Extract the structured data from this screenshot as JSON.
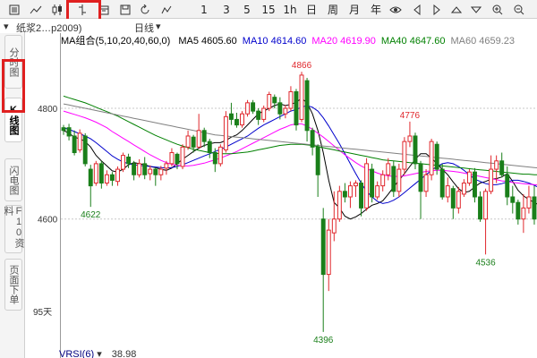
{
  "toolbar": {
    "items": [
      {
        "name": "list-icon"
      },
      {
        "name": "line-chart-icon"
      },
      {
        "name": "candlestick-icon"
      },
      {
        "name": "bar-ohlc-icon"
      },
      {
        "name": "calendar-icon"
      },
      {
        "name": "save-icon"
      },
      {
        "name": "refresh-icon"
      },
      {
        "name": "draw-tool-icon"
      },
      {
        "name": "period-1min",
        "label": "1"
      },
      {
        "name": "period-3min",
        "label": "3"
      },
      {
        "name": "period-5min",
        "label": "5"
      },
      {
        "name": "period-15min",
        "label": "15"
      },
      {
        "name": "period-1h",
        "label": "1h"
      },
      {
        "name": "period-day",
        "label": "日"
      },
      {
        "name": "period-week",
        "label": "周"
      },
      {
        "name": "period-month",
        "label": "月"
      },
      {
        "name": "period-year",
        "label": "年"
      },
      {
        "name": "eye-icon"
      },
      {
        "name": "arrow-left-icon"
      },
      {
        "name": "arrow-right-icon"
      },
      {
        "name": "arrow-up-icon"
      },
      {
        "name": "arrow-down-icon"
      },
      {
        "name": "zoom-in-icon"
      },
      {
        "name": "zoom-out-icon"
      }
    ]
  },
  "info_row": {
    "contract": "纸浆2…p2009)",
    "period": "日线"
  },
  "left_tabs": [
    {
      "label": "分时图",
      "active": false
    },
    {
      "label": "K线图",
      "active": true
    },
    {
      "label": "闪电图",
      "active": false
    },
    {
      "label": "F10资料",
      "active": false
    },
    {
      "label": "页面下单",
      "active": false
    }
  ],
  "ma_legend": {
    "title": "MA组合(5,10,20,40,60,0)",
    "items": [
      {
        "label": "MA5 4605.60",
        "color": "#000000"
      },
      {
        "label": "MA10 4614.60",
        "color": "#0000cc"
      },
      {
        "label": "MA20 4619.90",
        "color": "#ff00ff"
      },
      {
        "label": "MA40 4647.60",
        "color": "#008000"
      },
      {
        "label": "MA60 4659.23",
        "color": "#808080"
      }
    ]
  },
  "bottom": {
    "days_label": "95天",
    "vrsi_label": "VRSI(6)",
    "vrsi_value": "38.98"
  },
  "colors": {
    "up": "#e0282d",
    "down": "#1a7f1a",
    "annotation_red": "#e0282d",
    "annotation_green": "#1a7f1a",
    "grid": "#c8c8c8"
  },
  "chart_data": {
    "type": "candlestick",
    "yticks": [
      4800,
      4600
    ],
    "ylim": [
      4370,
      4910
    ],
    "annotations": [
      {
        "label": "4866",
        "index": 44,
        "value": 4866,
        "position": "above",
        "color": "red"
      },
      {
        "label": "4776",
        "index": 64,
        "value": 4776,
        "position": "above",
        "color": "red"
      },
      {
        "label": "4622",
        "index": 5,
        "value": 4622,
        "position": "below",
        "color": "green"
      },
      {
        "label": "4396",
        "index": 48,
        "value": 4396,
        "position": "below",
        "color": "green"
      },
      {
        "label": "4536",
        "index": 78,
        "value": 4536,
        "position": "below",
        "color": "green"
      }
    ],
    "candles": [
      [
        4765,
        4760,
        4770,
        4752
      ],
      [
        4765,
        4750,
        4772,
        4742
      ],
      [
        4750,
        4720,
        4760,
        4715
      ],
      [
        4725,
        4755,
        4762,
        4720
      ],
      [
        4750,
        4700,
        4755,
        4695
      ],
      [
        4690,
        4660,
        4698,
        4622
      ],
      [
        4665,
        4700,
        4705,
        4660
      ],
      [
        4700,
        4665,
        4705,
        4655
      ],
      [
        4665,
        4680,
        4688,
        4660
      ],
      [
        4680,
        4670,
        4685,
        4660
      ],
      [
        4668,
        4690,
        4695,
        4660
      ],
      [
        4690,
        4715,
        4720,
        4685
      ],
      [
        4712,
        4700,
        4718,
        4692
      ],
      [
        4700,
        4680,
        4705,
        4670
      ],
      [
        4680,
        4700,
        4708,
        4675
      ],
      [
        4700,
        4680,
        4712,
        4672
      ],
      [
        4682,
        4690,
        4697,
        4670
      ],
      [
        4690,
        4680,
        4693,
        4660
      ],
      [
        4680,
        4690,
        4696,
        4670
      ],
      [
        4692,
        4700,
        4705,
        4680
      ],
      [
        4700,
        4720,
        4728,
        4695
      ],
      [
        4717,
        4700,
        4720,
        4690
      ],
      [
        4695,
        4730,
        4735,
        4690
      ],
      [
        4730,
        4750,
        4760,
        4725
      ],
      [
        4748,
        4730,
        4752,
        4720
      ],
      [
        4730,
        4760,
        4790,
        4728
      ],
      [
        4760,
        4740,
        4765,
        4730
      ],
      [
        4740,
        4720,
        4745,
        4710
      ],
      [
        4720,
        4700,
        4728,
        4685
      ],
      [
        4700,
        4730,
        4735,
        4695
      ],
      [
        4725,
        4785,
        4795,
        4720
      ],
      [
        4790,
        4780,
        4810,
        4770
      ],
      [
        4780,
        4770,
        4792,
        4765
      ],
      [
        4770,
        4790,
        4795,
        4765
      ],
      [
        4790,
        4810,
        4815,
        4785
      ],
      [
        4810,
        4795,
        4815,
        4790
      ],
      [
        4795,
        4780,
        4800,
        4770
      ],
      [
        4780,
        4800,
        4805,
        4775
      ],
      [
        4800,
        4825,
        4830,
        4795
      ],
      [
        4820,
        4810,
        4825,
        4800
      ],
      [
        4810,
        4790,
        4820,
        4780
      ],
      [
        4790,
        4800,
        4806,
        4782
      ],
      [
        4800,
        4830,
        4840,
        4795
      ],
      [
        4830,
        4770,
        4835,
        4760
      ],
      [
        4780,
        4860,
        4866,
        4775
      ],
      [
        4850,
        4760,
        4855,
        4740
      ],
      [
        4760,
        4730,
        4765,
        4715
      ],
      [
        4730,
        4680,
        4735,
        4640
      ],
      [
        4600,
        4500,
        4620,
        4396
      ],
      [
        4500,
        4580,
        4600,
        4470
      ],
      [
        4575,
        4600,
        4650,
        4560
      ],
      [
        4600,
        4650,
        4660,
        4595
      ],
      [
        4650,
        4640,
        4665,
        4630
      ],
      [
        4640,
        4660,
        4668,
        4620
      ],
      [
        4660,
        4665,
        4670,
        4640
      ],
      [
        4665,
        4620,
        4670,
        4605
      ],
      [
        4620,
        4700,
        4710,
        4615
      ],
      [
        4690,
        4640,
        4700,
        4630
      ],
      [
        4640,
        4660,
        4668,
        4635
      ],
      [
        4660,
        4680,
        4688,
        4650
      ],
      [
        4680,
        4700,
        4710,
        4670
      ],
      [
        4695,
        4650,
        4705,
        4640
      ],
      [
        4650,
        4690,
        4700,
        4640
      ],
      [
        4690,
        4740,
        4748,
        4680
      ],
      [
        4740,
        4750,
        4776,
        4730
      ],
      [
        4750,
        4700,
        4756,
        4690
      ],
      [
        4700,
        4650,
        4705,
        4600
      ],
      [
        4650,
        4680,
        4690,
        4640
      ],
      [
        4680,
        4740,
        4745,
        4670
      ],
      [
        4735,
        4690,
        4740,
        4680
      ],
      [
        4690,
        4640,
        4700,
        4635
      ],
      [
        4640,
        4660,
        4675,
        4630
      ],
      [
        4655,
        4620,
        4660,
        4600
      ],
      [
        4620,
        4650,
        4658,
        4610
      ],
      [
        4645,
        4665,
        4672,
        4640
      ],
      [
        4665,
        4685,
        4690,
        4660
      ],
      [
        4685,
        4640,
        4692,
        4630
      ],
      [
        4640,
        4600,
        4650,
        4595
      ],
      [
        4600,
        4650,
        4655,
        4536
      ],
      [
        4650,
        4690,
        4715,
        4645
      ],
      [
        4690,
        4705,
        4715,
        4665
      ],
      [
        4705,
        4680,
        4720,
        4675
      ],
      [
        4680,
        4640,
        4695,
        4625
      ],
      [
        4640,
        4630,
        4660,
        4610
      ],
      [
        4630,
        4600,
        4635,
        4590
      ],
      [
        4600,
        4620,
        4645,
        4575
      ],
      [
        4620,
        4640,
        4660,
        4610
      ],
      [
        4640,
        4600,
        4660,
        4590
      ]
    ],
    "ma_lines": [
      {
        "name": "MA5",
        "color": "#000000",
        "values": [
          4760,
          4755,
          4748,
          4745,
          4740,
          4730,
          4715,
          4705,
          4696,
          4687,
          4685,
          4690,
          4698,
          4702,
          4700,
          4698,
          4695,
          4693,
          4690,
          4688,
          4692,
          4700,
          4708,
          4715,
          4722,
          4728,
          4733,
          4736,
          4738,
          4738,
          4742,
          4748,
          4752,
          4760,
          4770,
          4780,
          4790,
          4795,
          4800,
          4805,
          4808,
          4805,
          4807,
          4811,
          4818,
          4810,
          4790,
          4760,
          4720,
          4670,
          4630,
          4620,
          4605,
          4600,
          4604,
          4610,
          4618,
          4625,
          4628,
          4633,
          4645,
          4658,
          4670,
          4682,
          4695,
          4708,
          4718,
          4718,
          4710,
          4700,
          4690,
          4680,
          4667,
          4655,
          4648,
          4650,
          4658,
          4665,
          4668,
          4672,
          4673,
          4676,
          4682,
          4668,
          4652,
          4642,
          4635,
          4630,
          4625
        ]
      },
      {
        "name": "MA10",
        "color": "#0000cc",
        "values": [
          4765,
          4762,
          4758,
          4754,
          4750,
          4745,
          4738,
          4730,
          4722,
          4714,
          4708,
          4703,
          4700,
          4698,
          4697,
          4696,
          4695,
          4694,
          4693,
          4692,
          4693,
          4695,
          4698,
          4702,
          4706,
          4710,
          4714,
          4718,
          4722,
          4726,
          4730,
          4735,
          4740,
          4745,
          4750,
          4757,
          4764,
          4770,
          4775,
          4780,
          4785,
          4790,
          4795,
          4798,
          4802,
          4805,
          4802,
          4795,
          4783,
          4768,
          4752,
          4736,
          4718,
          4700,
          4682,
          4665,
          4650,
          4640,
          4632,
          4628,
          4630,
          4634,
          4640,
          4648,
          4656,
          4664,
          4672,
          4680,
          4688,
          4695,
          4700,
          4702,
          4700,
          4695,
          4688,
          4680,
          4672,
          4668,
          4664,
          4662,
          4662,
          4664,
          4667,
          4670,
          4670,
          4668,
          4665,
          4661,
          4656
        ]
      },
      {
        "name": "MA20",
        "color": "#ff00ff",
        "values": [
          4795,
          4792,
          4789,
          4786,
          4783,
          4779,
          4775,
          4770,
          4765,
          4758,
          4752,
          4746,
          4740,
          4734,
          4728,
          4722,
          4716,
          4711,
          4706,
          4702,
          4699,
          4697,
          4696,
          4696,
          4697,
          4699,
          4701,
          4704,
          4707,
          4710,
          4714,
          4718,
          4722,
          4727,
          4732,
          4737,
          4742,
          4747,
          4752,
          4757,
          4762,
          4766,
          4770,
          4772,
          4772,
          4768,
          4762,
          4755,
          4748,
          4740,
          4732,
          4724,
          4716,
          4709,
          4702,
          4696,
          4691,
          4687,
          4683,
          4680,
          4678,
          4677,
          4677,
          4678,
          4680,
          4682,
          4684,
          4686,
          4687,
          4688,
          4688,
          4687,
          4686,
          4685,
          4683,
          4681,
          4679,
          4677,
          4675,
          4673,
          4671,
          4669,
          4668,
          4666,
          4665,
          4664,
          4663,
          4662,
          4662
        ]
      },
      {
        "name": "MA40",
        "color": "#008000",
        "values": [
          4822,
          4819,
          4816,
          4813,
          4810,
          4806,
          4802,
          4798,
          4794,
          4790,
          4786,
          4781,
          4776,
          4771,
          4766,
          4761,
          4756,
          4751,
          4747,
          4743,
          4739,
          4735,
          4732,
          4729,
          4726,
          4724,
          4722,
          4720,
          4719,
          4718,
          4718,
          4718,
          4719,
          4720,
          4721,
          4723,
          4725,
          4727,
          4729,
          4731,
          4733,
          4734,
          4735,
          4735,
          4735,
          4734,
          4733,
          4731,
          4729,
          4727,
          4725,
          4723,
          4721,
          4719,
          4717,
          4715,
          4713,
          4711,
          4709,
          4707,
          4706,
          4705,
          4704,
          4703,
          4702,
          4701,
          4700,
          4699,
          4698,
          4697,
          4696,
          4695,
          4694,
          4693,
          4692,
          4691,
          4690,
          4689,
          4688,
          4687,
          4686,
          4685,
          4684,
          4683,
          4682,
          4681,
          4681,
          4680,
          4680
        ]
      },
      {
        "name": "MA60",
        "color": "#808080",
        "values": [
          4808,
          4806,
          4804,
          4802,
          4800,
          4798,
          4796,
          4794,
          4792,
          4790,
          4788,
          4786,
          4784,
          4782,
          4780,
          4778,
          4776,
          4774,
          4772,
          4770,
          4768,
          4766,
          4764,
          4762,
          4760,
          4758,
          4756,
          4754,
          4752,
          4751,
          4750,
          4749,
          4748,
          4747,
          4746,
          4745,
          4744,
          4743,
          4742,
          4741,
          4740,
          4739,
          4738,
          4737,
          4736,
          4735,
          4734,
          4733,
          4732,
          4731,
          4730,
          4729,
          4728,
          4727,
          4726,
          4725,
          4724,
          4723,
          4722,
          4721,
          4720,
          4719,
          4718,
          4717,
          4716,
          4715,
          4714,
          4713,
          4712,
          4711,
          4710,
          4709,
          4708,
          4707,
          4706,
          4705,
          4704,
          4703,
          4702,
          4701,
          4700,
          4699,
          4698,
          4697,
          4696,
          4695,
          4694,
          4693,
          4692
        ]
      }
    ]
  }
}
